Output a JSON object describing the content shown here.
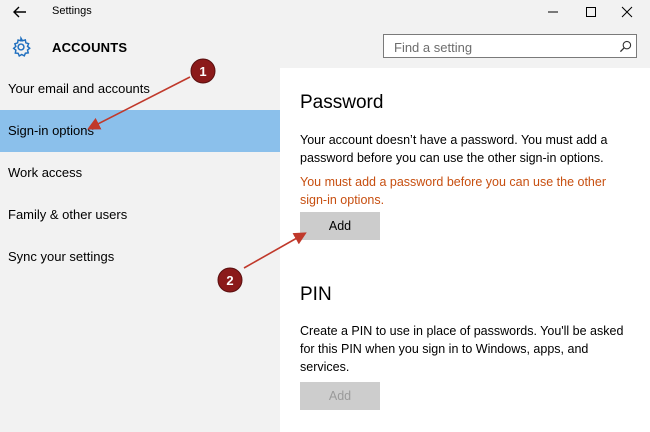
{
  "window": {
    "title": "Settings"
  },
  "header": {
    "section_title": "ACCOUNTS",
    "search_placeholder": "Find a setting"
  },
  "sidebar": {
    "items": [
      {
        "label": "Your email and accounts",
        "active": false
      },
      {
        "label": "Sign-in options",
        "active": true
      },
      {
        "label": "Work access",
        "active": false
      },
      {
        "label": "Family & other users",
        "active": false
      },
      {
        "label": "Sync your settings",
        "active": false
      }
    ]
  },
  "password": {
    "heading": "Password",
    "description": "Your account doesn’t have a password. You must add a password before you can use the other sign-in options.",
    "warning": "You must add a password before you can use the other sign-in options.",
    "add_label": "Add"
  },
  "pin": {
    "heading": "PIN",
    "description": "Create a PIN to use in place of passwords. You'll be asked for this PIN when you sign in to Windows, apps, and services.",
    "add_label": "Add"
  },
  "annotations": {
    "badge_1": "1",
    "badge_2": "2"
  },
  "colors": {
    "sidebar_bg": "#f2f2f2",
    "active_item": "#8bc0eb",
    "warning_text": "#c74f10",
    "annotation": "#8b1a1a"
  }
}
